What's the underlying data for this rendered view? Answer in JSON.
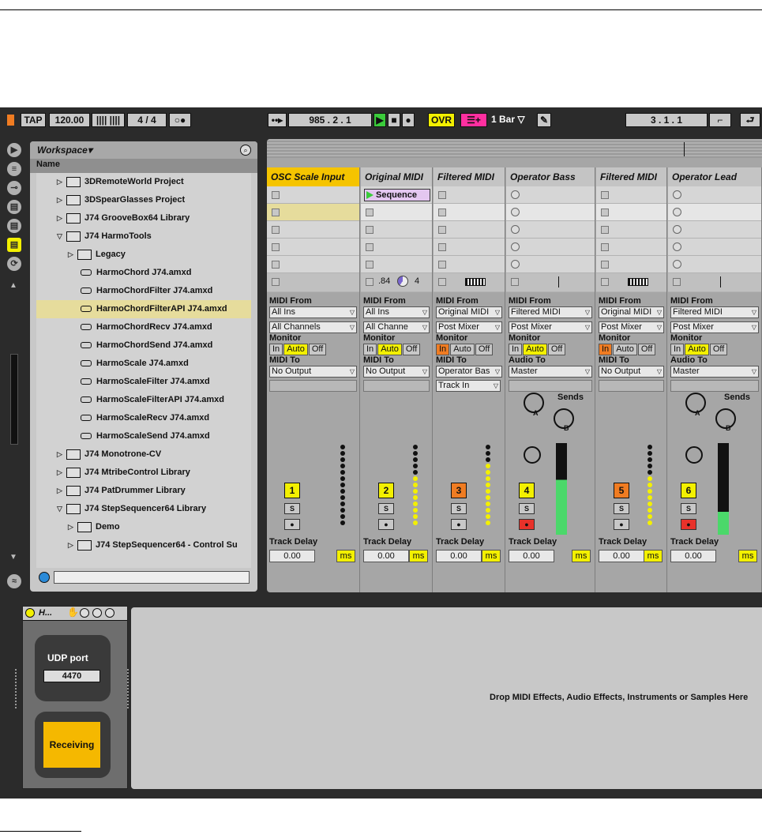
{
  "toolbar": {
    "tap": "TAP",
    "tempo": "120.00",
    "sig_num": "4",
    "sig_sep": "/",
    "sig_den": "4",
    "position": "985 .  2 .  1",
    "ovr": "OVR",
    "quant": "1 Bar",
    "loop_pos": "3 .  1 .  1"
  },
  "browser": {
    "title": "Workspace",
    "column": "Name",
    "items": [
      {
        "label": "3DRemoteWorld Project",
        "kind": "project",
        "indent": 1,
        "tri": "▷"
      },
      {
        "label": "3DSpearGlasses Project",
        "kind": "project",
        "indent": 1,
        "tri": "▷"
      },
      {
        "label": "J74 GrooveBox64 Library",
        "kind": "folder",
        "indent": 1,
        "tri": "▷"
      },
      {
        "label": "J74 HarmoTools",
        "kind": "folder",
        "indent": 1,
        "tri": "▽"
      },
      {
        "label": "Legacy",
        "kind": "folder",
        "indent": 2,
        "tri": "▷"
      },
      {
        "label": "HarmoChord J74.amxd",
        "kind": "device",
        "indent": 3,
        "tri": ""
      },
      {
        "label": "HarmoChordFilter J74.amxd",
        "kind": "device",
        "indent": 3,
        "tri": ""
      },
      {
        "label": "HarmoChordFilterAPI J74.amxd",
        "kind": "device",
        "indent": 3,
        "tri": "",
        "selected": true
      },
      {
        "label": "HarmoChordRecv J74.amxd",
        "kind": "device",
        "indent": 3,
        "tri": ""
      },
      {
        "label": "HarmoChordSend J74.amxd",
        "kind": "device",
        "indent": 3,
        "tri": ""
      },
      {
        "label": "HarmoScale J74.amxd",
        "kind": "device",
        "indent": 3,
        "tri": ""
      },
      {
        "label": "HarmoScaleFilter J74.amxd",
        "kind": "device",
        "indent": 3,
        "tri": ""
      },
      {
        "label": "HarmoScaleFilterAPI J74.amxd",
        "kind": "device",
        "indent": 3,
        "tri": ""
      },
      {
        "label": "HarmoScaleRecv J74.amxd",
        "kind": "device",
        "indent": 3,
        "tri": ""
      },
      {
        "label": "HarmoScaleSend J74.amxd",
        "kind": "device",
        "indent": 3,
        "tri": ""
      },
      {
        "label": "J74 Monotrone-CV",
        "kind": "folder",
        "indent": 1,
        "tri": "▷"
      },
      {
        "label": "J74 MtribeControl Library",
        "kind": "folder",
        "indent": 1,
        "tri": "▷"
      },
      {
        "label": "J74 PatDrummer Library",
        "kind": "folder",
        "indent": 1,
        "tri": "▷"
      },
      {
        "label": "J74 StepSequencer64 Library",
        "kind": "folder",
        "indent": 1,
        "tri": "▽"
      },
      {
        "label": "Demo",
        "kind": "folder",
        "indent": 2,
        "tri": "▷"
      },
      {
        "label": "J74 StepSequencer64 - Control Su",
        "kind": "folder",
        "indent": 2,
        "tri": "▷"
      }
    ]
  },
  "labels": {
    "midi_from": "MIDI From",
    "monitor": "Monitor",
    "midi_to": "MIDI To",
    "audio_to": "Audio To",
    "in": "In",
    "auto": "Auto",
    "off": "Off",
    "track_delay": "Track Delay",
    "delay_value": "0.00",
    "ms": "ms",
    "sends": "Sends",
    "a": "A",
    "b": "B",
    "s": "S",
    "sequence": "Sequence",
    "clip_ratio": ".84",
    "clip_count": "4",
    "track_in": "Track In"
  },
  "tracks": [
    {
      "name": "OSC Scale Input",
      "num": "1",
      "color": "#f3f000",
      "from": "All Ins",
      "chan": "All Channels",
      "mon": "auto",
      "to_label": "MIDI To",
      "to": "No Output",
      "title_bg": "#f5c400"
    },
    {
      "name": "Original MIDI",
      "num": "2",
      "color": "#f3f000",
      "from": "All Ins",
      "chan": "All Channe",
      "mon": "auto",
      "to_label": "MIDI To",
      "to": "No Output"
    },
    {
      "name": "Filtered MIDI",
      "num": "3",
      "color": "#f07c22",
      "from": "Original MIDI",
      "chan": "Post Mixer",
      "mon": "in",
      "to_label": "MIDI To",
      "to": "Operator Bas"
    },
    {
      "name": "Operator Bass",
      "num": "4",
      "color": "#f3f000",
      "from": "Filtered MIDI",
      "chan": "Post Mixer",
      "mon": "auto",
      "to_label": "Audio To",
      "to": "Master"
    },
    {
      "name": "Filtered MIDI",
      "num": "5",
      "color": "#f07c22",
      "from": "Original MIDI",
      "chan": "Post Mixer",
      "mon": "in",
      "to_label": "MIDI To",
      "to": "No Output"
    },
    {
      "name": "Operator Lead",
      "num": "6",
      "color": "#f3f000",
      "from": "Filtered MIDI",
      "chan": "Post Mixer",
      "mon": "auto",
      "to_label": "Audio To",
      "to": "Master"
    }
  ],
  "device": {
    "title": "H...",
    "udp_label": "UDP port",
    "udp_value": "4470",
    "status": "Receiving"
  },
  "dropzone": "Drop MIDI Effects, Audio Effects, Instruments or Samples Here"
}
